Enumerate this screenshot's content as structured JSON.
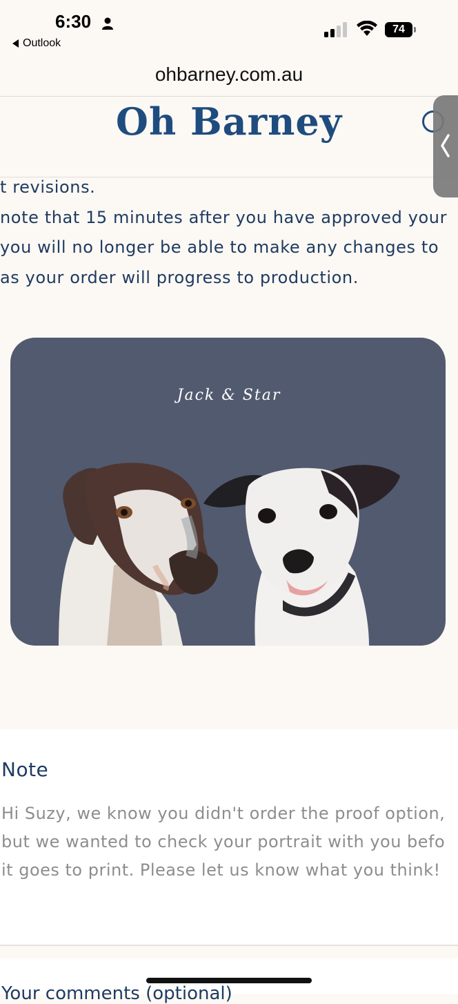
{
  "status_bar": {
    "time": "6:30",
    "back_app": "Outlook",
    "battery": "74"
  },
  "browser": {
    "url": "ohbarney.com.au"
  },
  "site": {
    "logo": "Oh Barney"
  },
  "content": {
    "lines": [
      "t revisions.",
      " note that 15 minutes after you have approved your",
      "you will no longer be able to make any changes to",
      "as your order will progress to production."
    ]
  },
  "portrait": {
    "title": "Jack & Star"
  },
  "note": {
    "title": "Note",
    "lines": [
      "Hi Suzy, we know you didn't order the proof option,",
      "but we wanted to check your portrait with you befo",
      "it goes to print. Please let us know what you think!"
    ]
  },
  "next_section": {
    "label": "Your comments (optional)"
  },
  "colors": {
    "brand": "#1f4c7e",
    "text": "#1e3b60",
    "card": "#525a6f",
    "background": "#fcf8f4"
  }
}
